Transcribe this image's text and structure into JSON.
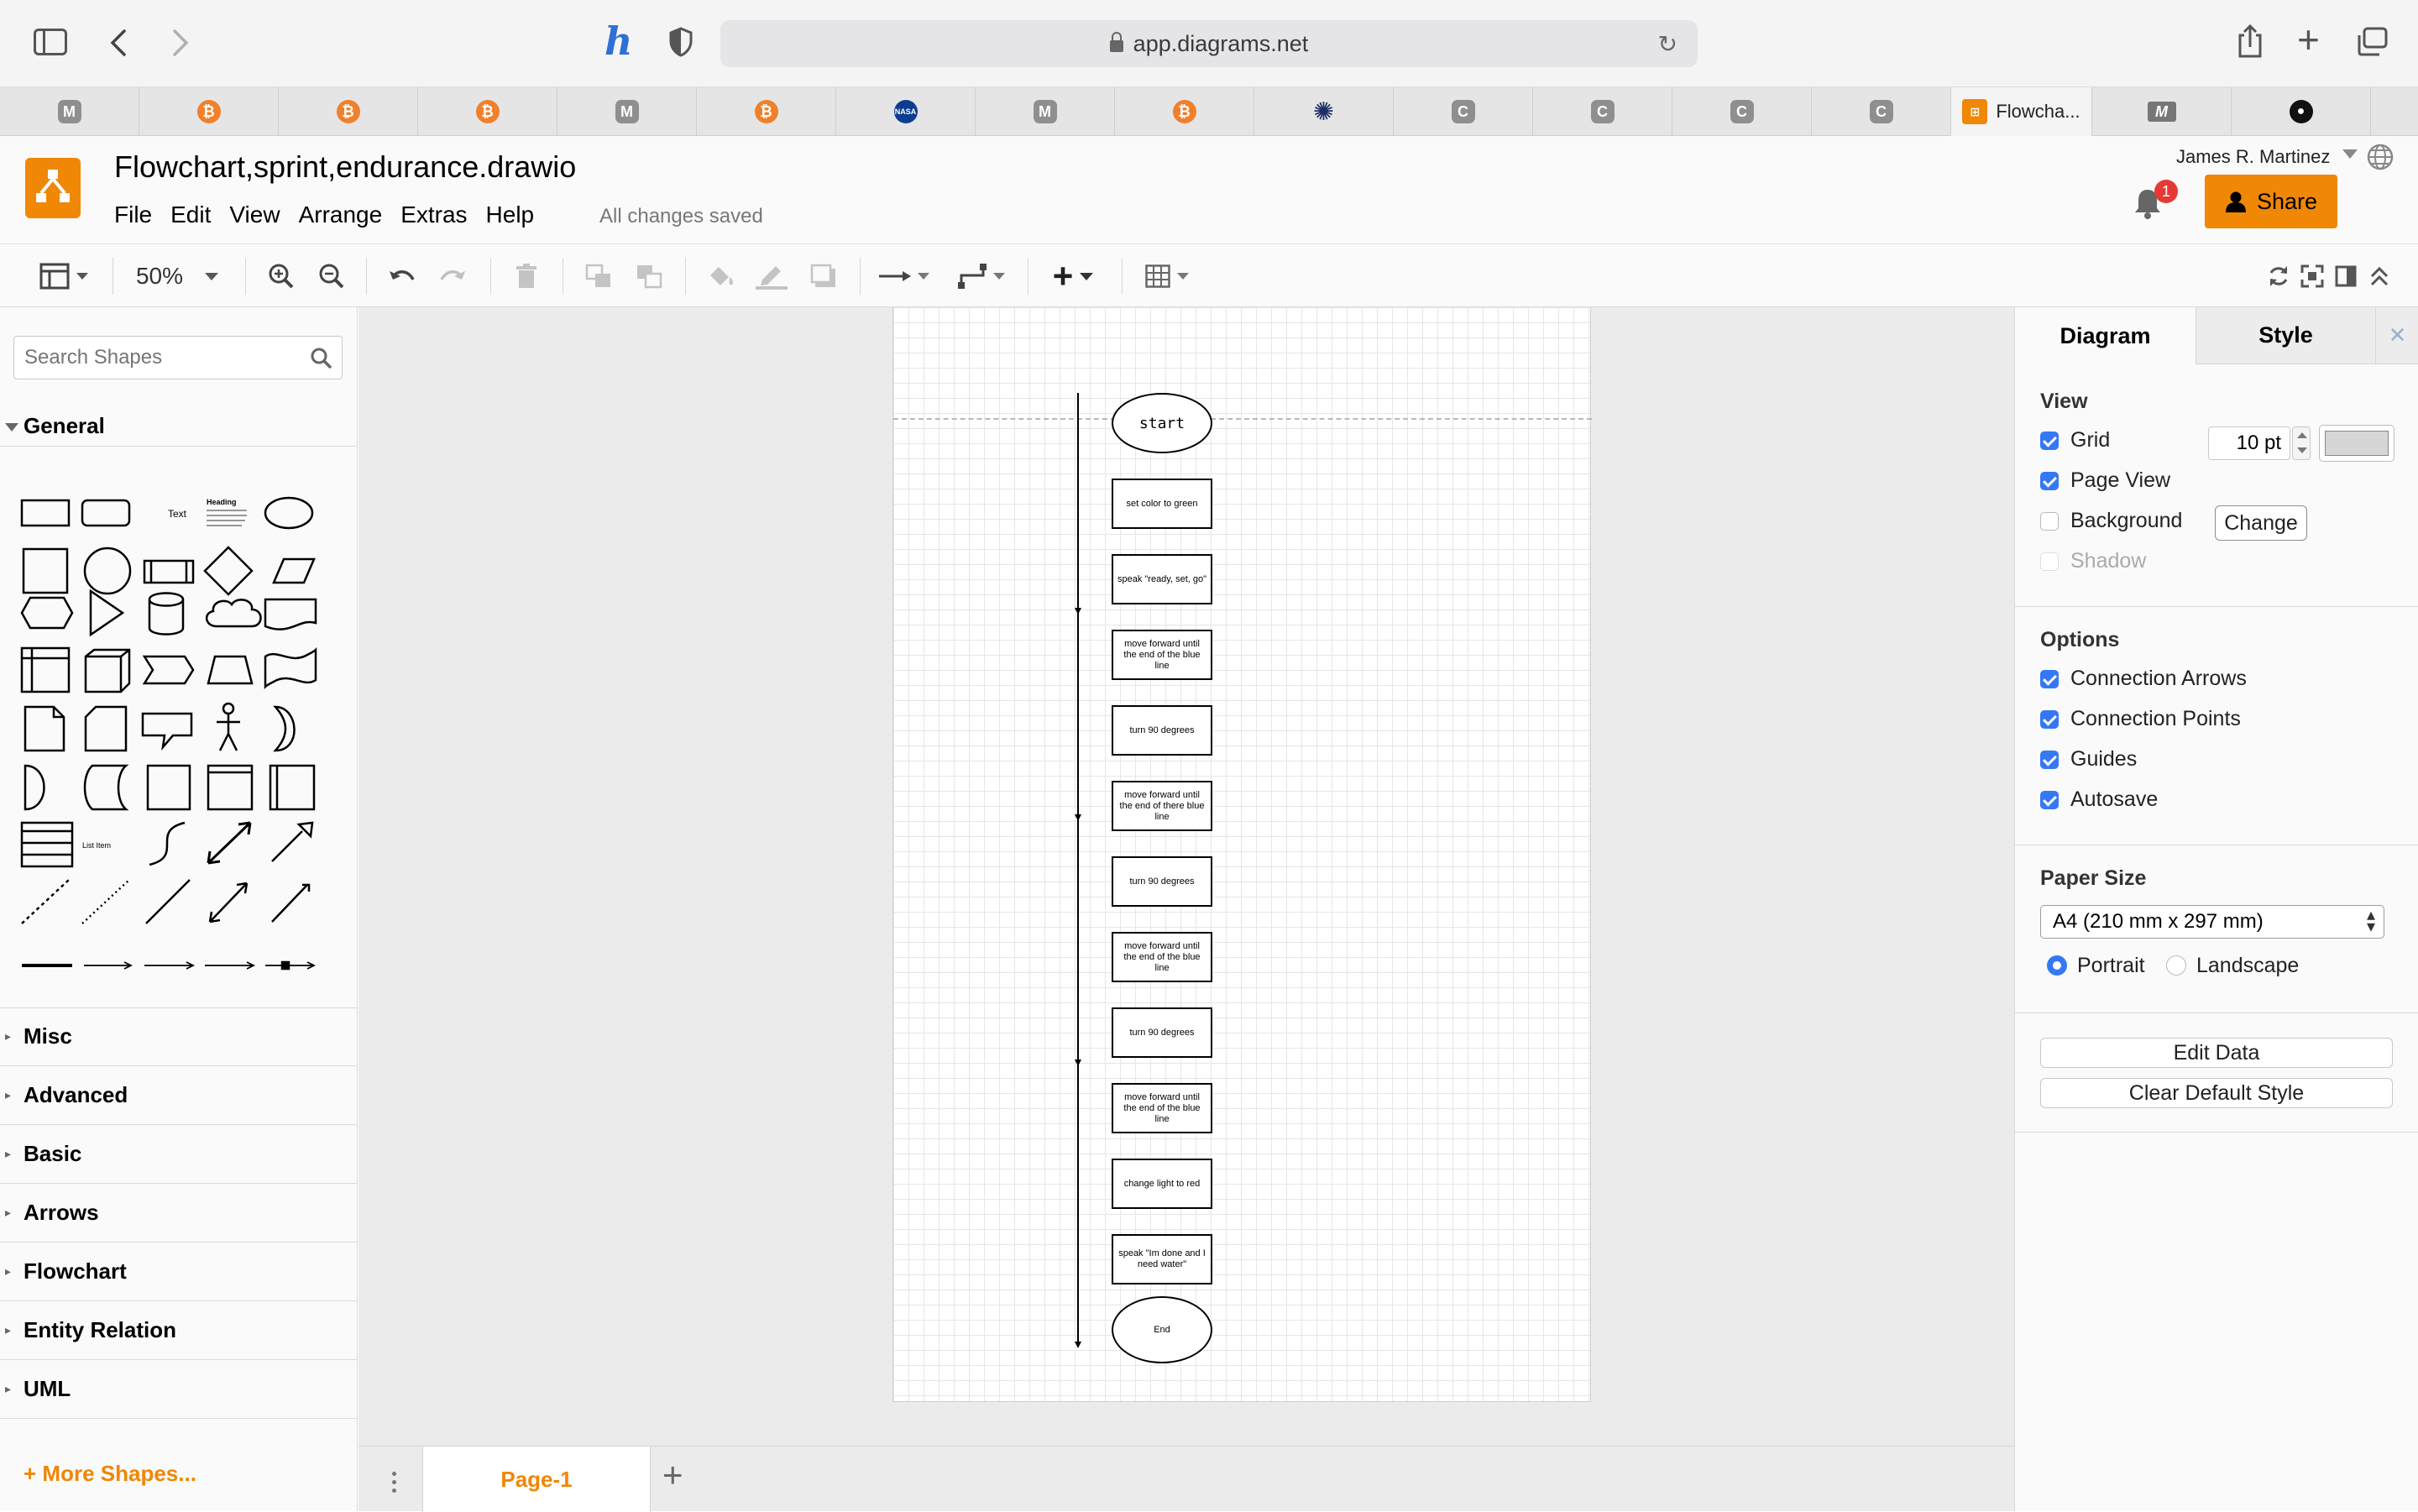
{
  "browser": {
    "url": "app.diagrams.net",
    "tabs": [
      {
        "icon": "M",
        "color": "#8f8f8f"
      },
      {
        "icon": "B",
        "color": "#f0802a"
      },
      {
        "icon": "B",
        "color": "#f0802a"
      },
      {
        "icon": "B",
        "color": "#f0802a"
      },
      {
        "icon": "M",
        "color": "#8f8f8f"
      },
      {
        "icon": "B",
        "color": "#f0802a"
      },
      {
        "icon": "nasa",
        "color": "#0b3d91"
      },
      {
        "icon": "M",
        "color": "#8f8f8f"
      },
      {
        "icon": "B",
        "color": "#f0802a"
      },
      {
        "icon": "pinwheel",
        "color": "#1b2f66"
      },
      {
        "icon": "C",
        "color": "#8f8f8f"
      },
      {
        "icon": "C",
        "color": "#8f8f8f"
      },
      {
        "icon": "C",
        "color": "#8f8f8f"
      },
      {
        "icon": "C",
        "color": "#8f8f8f"
      }
    ],
    "active_tab_label": "Flowcha...",
    "active_tab_icon_color": "#f08705"
  },
  "app": {
    "title": "Flowchart,sprint,endurance.drawio",
    "menus": [
      "File",
      "Edit",
      "View",
      "Arrange",
      "Extras",
      "Help"
    ],
    "save_status": "All changes saved",
    "user": "James R. Martinez",
    "notification_count": "1",
    "share_label": "Share",
    "accent": "#f08705"
  },
  "toolbar": {
    "zoom": "50%"
  },
  "left_panel": {
    "search_placeholder": "Search Shapes",
    "general_label": "General",
    "shape_text_label": "Text",
    "shape_heading_label": "Heading",
    "shape_list_item_label": "List Item",
    "sections": [
      "Misc",
      "Advanced",
      "Basic",
      "Arrows",
      "Flowchart",
      "Entity Relation",
      "UML"
    ],
    "more_shapes": "More Shapes..."
  },
  "diagram": {
    "nodes": [
      {
        "shape": "ellipse",
        "text": "start"
      },
      {
        "shape": "rect",
        "text": "set color to green"
      },
      {
        "shape": "rect",
        "text": "speak \"ready, set, go\""
      },
      {
        "shape": "rect",
        "text": "move forward until the end of the blue line"
      },
      {
        "shape": "rect",
        "text": "turn  90 degrees"
      },
      {
        "shape": "rect",
        "text": "move forward until the end of there blue line"
      },
      {
        "shape": "rect",
        "text": "turn 90 degrees"
      },
      {
        "shape": "rect",
        "text": "move forward until the end of the blue line"
      },
      {
        "shape": "rect",
        "text": "turn 90 degrees"
      },
      {
        "shape": "rect",
        "text": "move forward until the end of the blue line"
      },
      {
        "shape": "rect",
        "text": "change light to red"
      },
      {
        "shape": "rect",
        "text": "speak \"Im done and I need water\""
      },
      {
        "shape": "ellipse",
        "text": "End"
      }
    ]
  },
  "page_tabs": {
    "current": "Page-1"
  },
  "right_panel": {
    "tabs": [
      "Diagram",
      "Style"
    ],
    "view_heading": "View",
    "grid_label": "Grid",
    "grid_size": "10 pt",
    "page_view_label": "Page View",
    "background_label": "Background",
    "change_label": "Change",
    "shadow_label": "Shadow",
    "options_heading": "Options",
    "options": [
      "Connection Arrows",
      "Connection Points",
      "Guides",
      "Autosave"
    ],
    "paper_heading": "Paper Size",
    "paper_size": "A4 (210 mm x 297 mm)",
    "portrait_label": "Portrait",
    "landscape_label": "Landscape",
    "edit_data_label": "Edit Data",
    "clear_style_label": "Clear Default Style"
  }
}
